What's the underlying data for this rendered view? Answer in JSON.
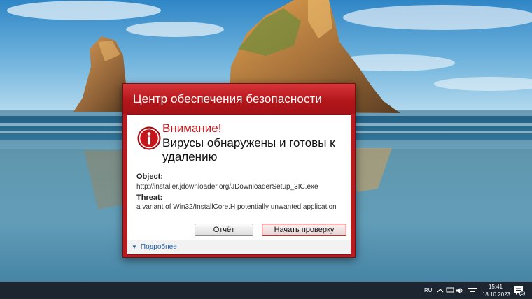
{
  "dialog": {
    "title": "Центр обеспечения безопасности",
    "heading": "Внимание!",
    "message": "Вирусы обнаружены и готовы к удалению",
    "object_label": "Object:",
    "object_value": "http://installer.jdownloader.org/JDownloaderSetup_3IC.exe",
    "threat_label": "Threat:",
    "threat_value": "a variant of Win32/InstallCore.H potentially unwanted application",
    "report_button": "Отчёт",
    "scan_button": "Начать проверку",
    "details_link": "Подробнее",
    "accent_color": "#c4161c"
  },
  "taskbar": {
    "language": "RU",
    "time": "15:41",
    "date": "18.10.2023",
    "notification_count": "5",
    "tray_icons": [
      "chevron-up-icon",
      "display-icon",
      "speaker-icon",
      "keyboard-icon",
      "notification-icon"
    ]
  }
}
